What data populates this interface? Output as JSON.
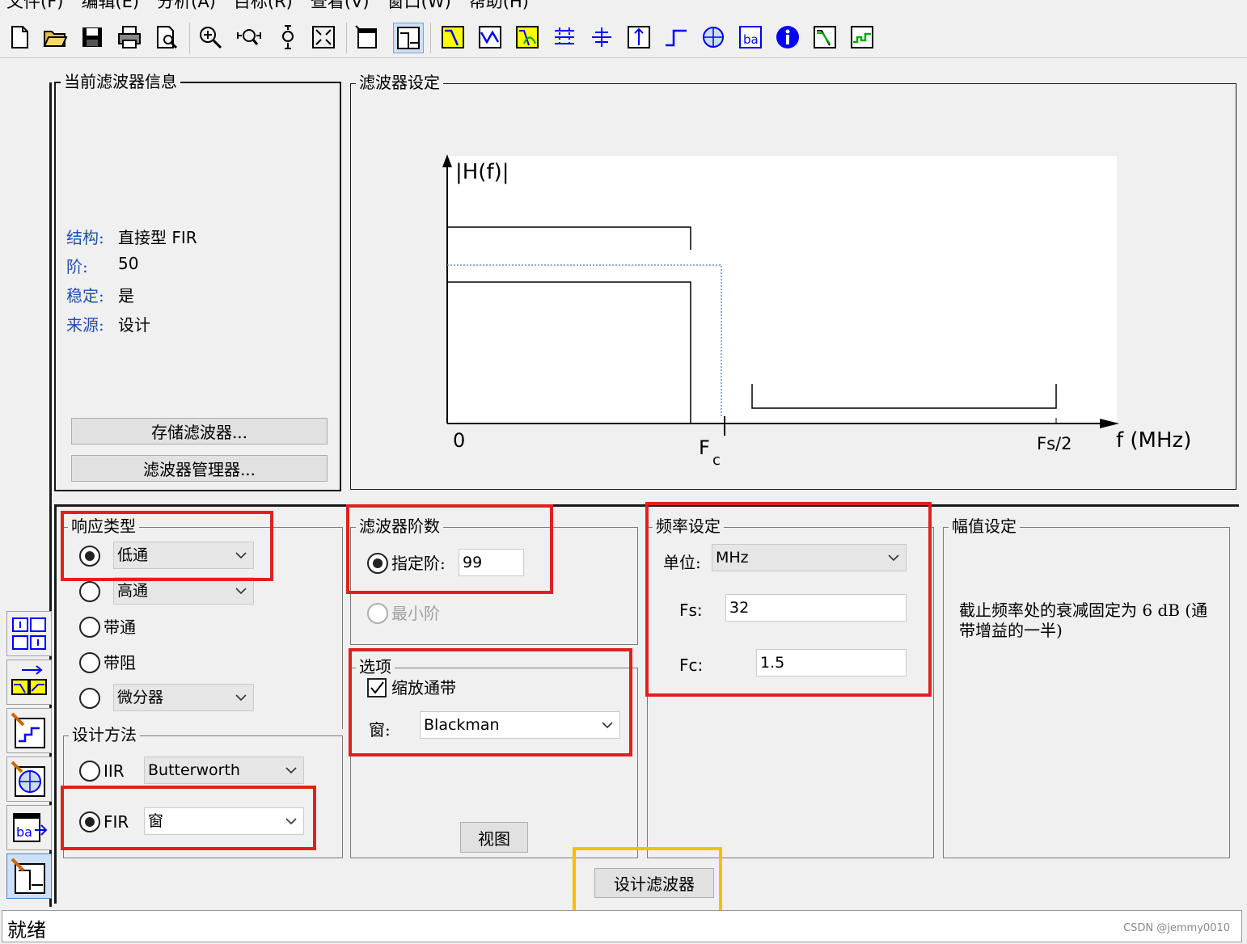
{
  "menu": [
    "文件(F)",
    "编辑(E)",
    "分析(A)",
    "目标(R)",
    "查看(V)",
    "窗口(W)",
    "帮助(H)"
  ],
  "toolbar": {
    "buttons": [
      {
        "name": "new-icon"
      },
      {
        "name": "open-icon"
      },
      {
        "name": "save-icon"
      },
      {
        "name": "print-icon"
      },
      {
        "name": "print-preview-icon"
      },
      {
        "name": "zoom-in-icon"
      },
      {
        "name": "zoom-x-icon"
      },
      {
        "name": "zoom-y-icon"
      },
      {
        "name": "full-view-icon"
      },
      {
        "name": "new-window-icon"
      },
      {
        "name": "filter-spec-icon"
      },
      {
        "name": "magnitude-response-icon"
      },
      {
        "name": "phase-response-icon"
      },
      {
        "name": "magnitude-phase-icon"
      },
      {
        "name": "group-delay-icon"
      },
      {
        "name": "phase-delay-icon"
      },
      {
        "name": "impulse-response-icon"
      },
      {
        "name": "step-response-icon"
      },
      {
        "name": "pole-zero-icon"
      },
      {
        "name": "coefficients-icon"
      },
      {
        "name": "filter-info-icon"
      },
      {
        "name": "magnitude-estimate-icon"
      },
      {
        "name": "noise-loop-icon"
      }
    ]
  },
  "sidebar": [
    "convert-structure-icon",
    "transform-filter-icon",
    "design-filter-icon",
    "pole-zero-editor-icon",
    "import-filter-icon",
    "filter-design-active-icon"
  ],
  "current_filter": {
    "title": "当前滤波器信息",
    "rows": [
      {
        "key": "结构:",
        "value": "直接型 FIR"
      },
      {
        "key": "阶:",
        "value": "50"
      },
      {
        "key": "稳定:",
        "value": "是"
      },
      {
        "key": "来源:",
        "value": "设计"
      }
    ],
    "store_button": "存储滤波器...",
    "manager_button": "滤波器管理器..."
  },
  "filter_spec": {
    "title": "滤波器设定",
    "y_label": "|H(f)|",
    "zero_label": "0",
    "fc_label": "F",
    "fc_sub": "c",
    "fs2_label": "Fs/2",
    "x_unit": "f (MHz)"
  },
  "response_type": {
    "title": "响应类型",
    "lowpass": "低通",
    "highpass": "高通",
    "bandpass": "带通",
    "bandstop": "带阻",
    "differentiator": "微分器",
    "selected": "低通"
  },
  "design_method": {
    "title": "设计方法",
    "iir_label": "IIR",
    "iir_value": "Butterworth",
    "fir_label": "FIR",
    "fir_value": "窗",
    "selected": "FIR"
  },
  "filter_order": {
    "title": "滤波器阶数",
    "specify_label": "指定阶:",
    "specify_value": "99",
    "minimum_label": "最小阶"
  },
  "options": {
    "title": "选项",
    "scale_passband": "缩放通带",
    "scale_checked": true,
    "window_label": "窗:",
    "window_value": "Blackman",
    "view_button": "视图"
  },
  "frequency": {
    "title": "频率设定",
    "units_label": "单位:",
    "units_value": "MHz",
    "fs_label": "Fs:",
    "fs_value": "32",
    "fc_label": "Fc:",
    "fc_value": "1.5"
  },
  "magnitude": {
    "title": "幅值设定",
    "text": "截止频率处的衰减固定为 6 dB (通带增益的一半)"
  },
  "design_button": "设计滤波器",
  "status": "就绪",
  "watermark": "CSDN @jemmy0010",
  "colors": {
    "highlight_red": "#e02020",
    "highlight_yellow": "#f5c000",
    "info_key_blue": "#1f4fb0"
  }
}
